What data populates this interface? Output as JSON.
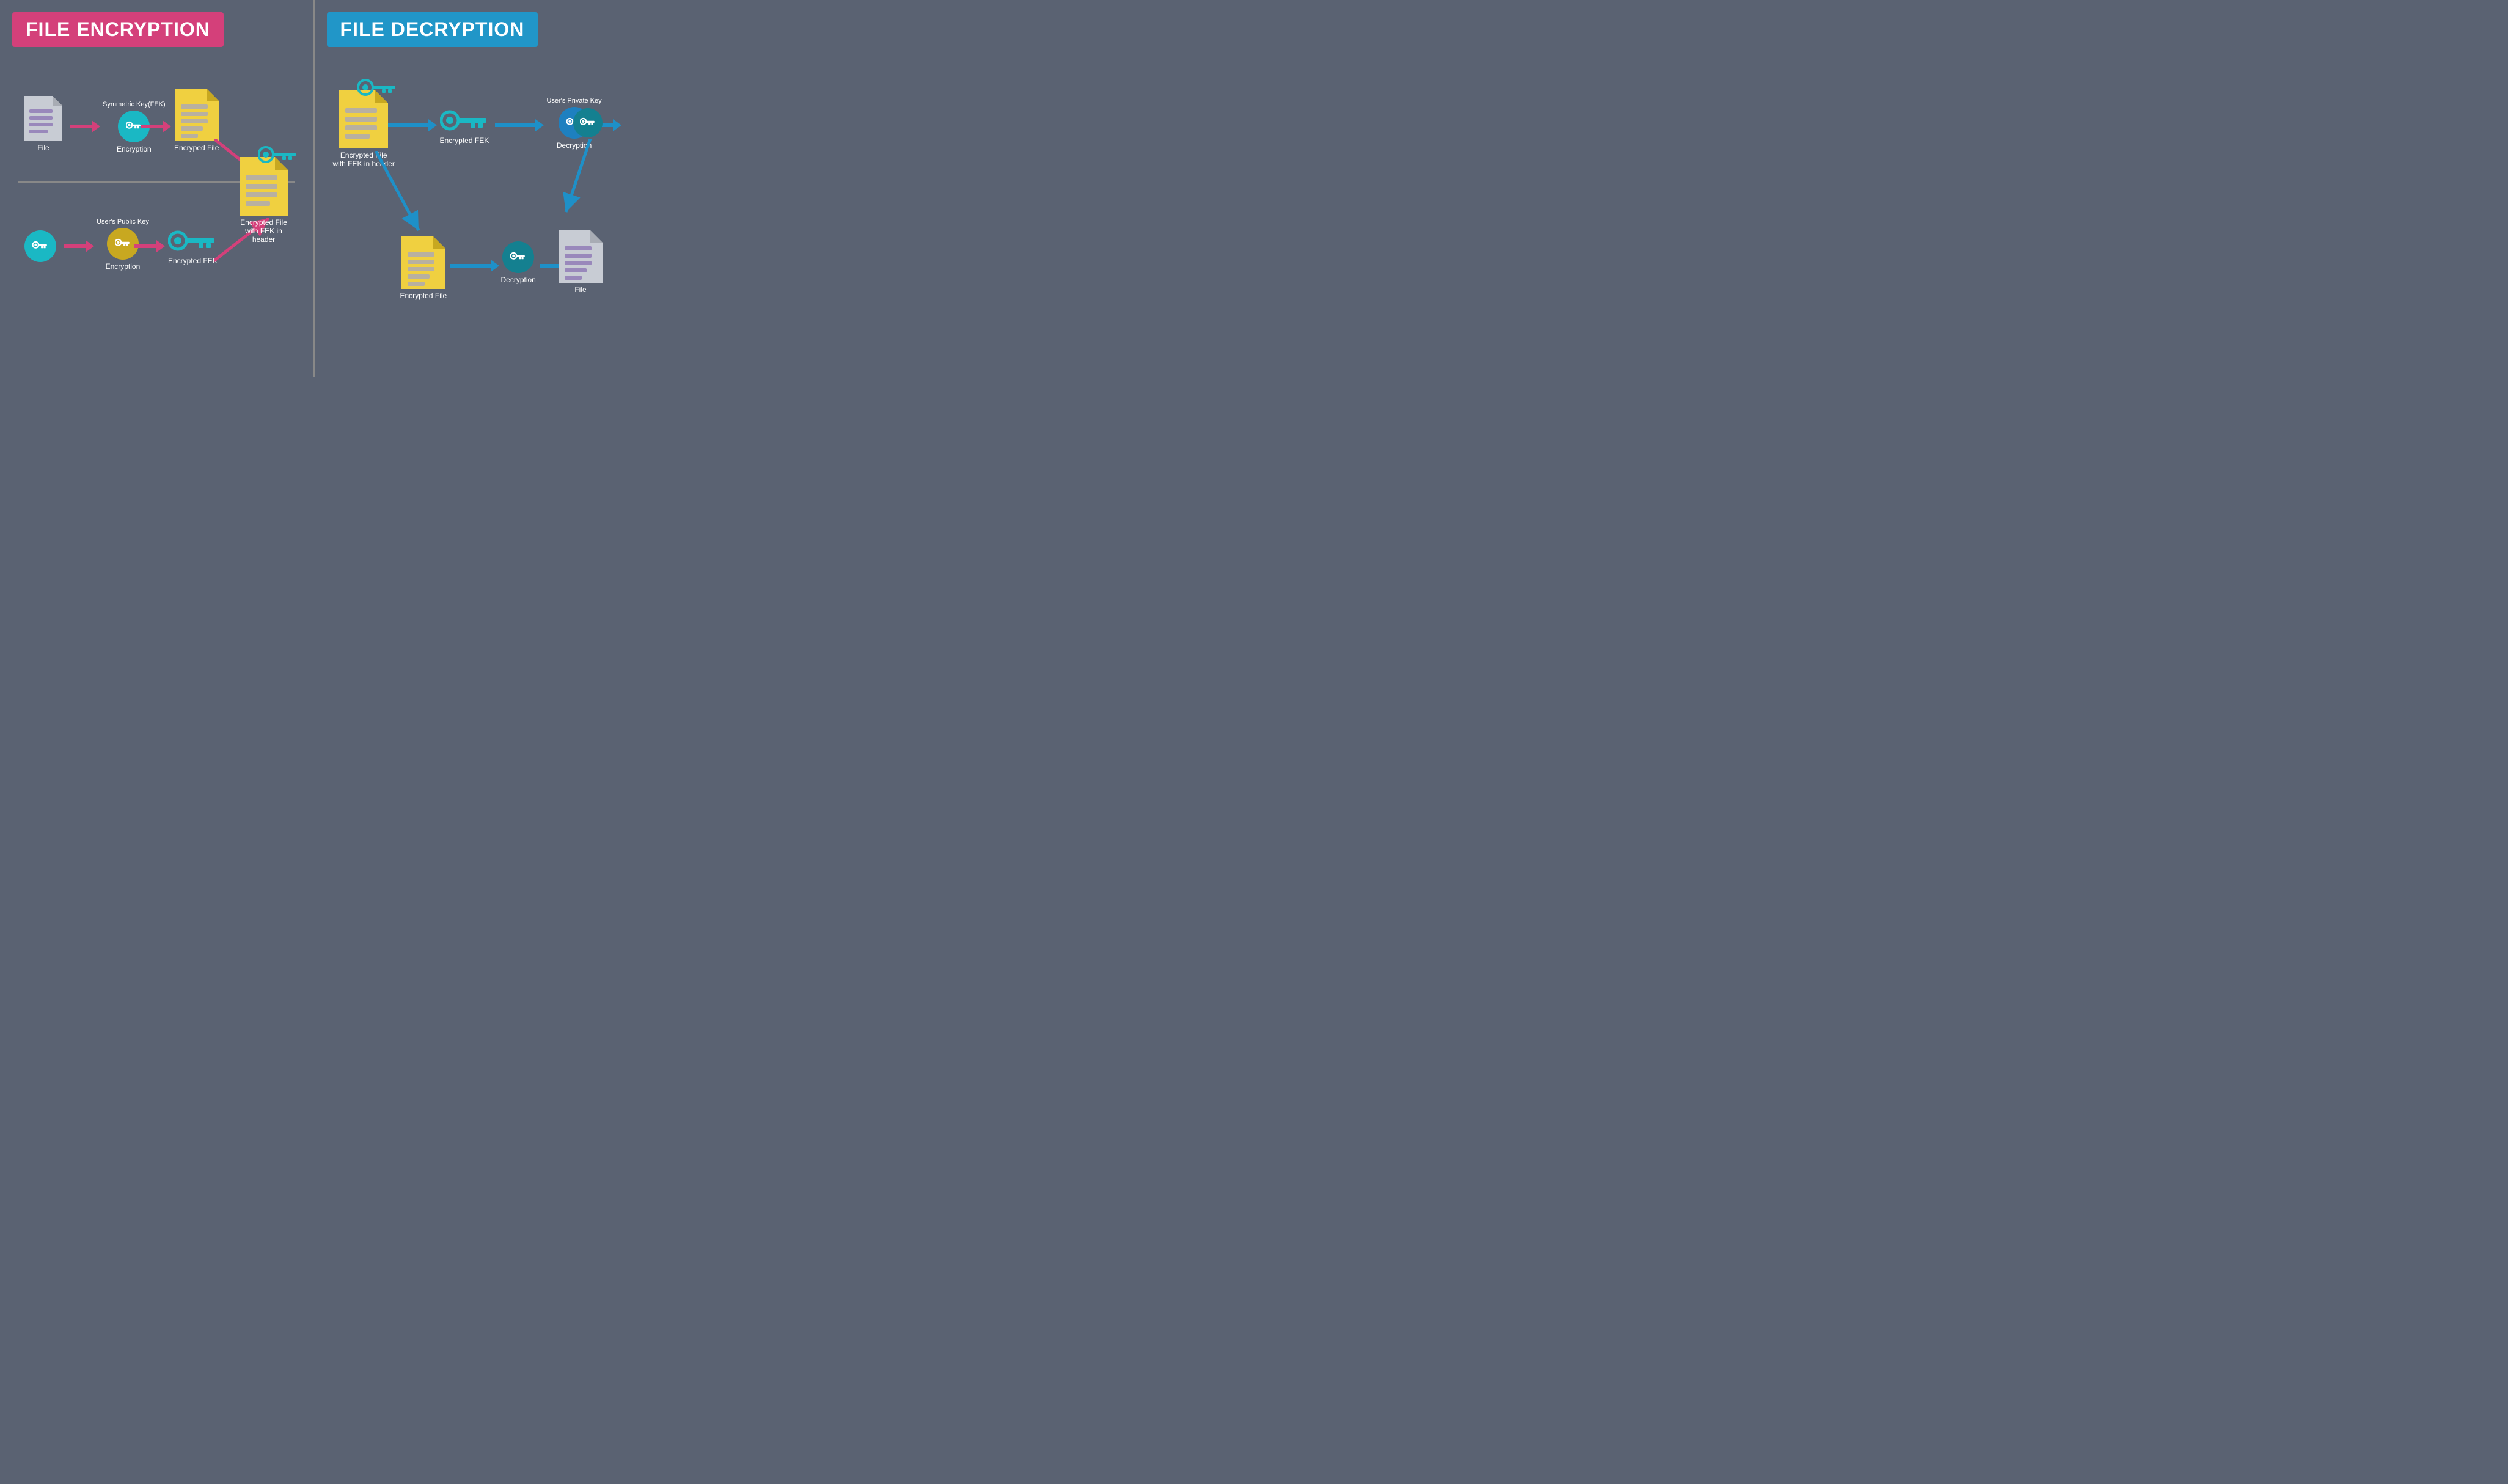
{
  "left": {
    "title": "FILE ENCRYPTION",
    "items": {
      "file_label": "File",
      "encryption1_label": "Encryption",
      "encrypted_file_label": "Encryped File",
      "symmetric_key_label": "Symmetric Key(FEK)",
      "public_key_label": "User's Public Key",
      "encryption2_label": "Encryption",
      "encrypted_fek_label": "Encrypted FEK",
      "result_label": "Encrypted File\nwith FEK in header"
    }
  },
  "right": {
    "title": "FILE DECRYPTION",
    "items": {
      "encrypted_file_header_label": "Encrypted File\nwith FEK in header",
      "encrypted_fek_label": "Encrypted FEK",
      "decryption1_label": "Decryption",
      "private_key_label": "User's Private Key",
      "decrypted_key_label": "Decryption",
      "encrypted_file2_label": "Encrypted File",
      "decryption2_label": "Decryption",
      "file_label": "File"
    }
  }
}
